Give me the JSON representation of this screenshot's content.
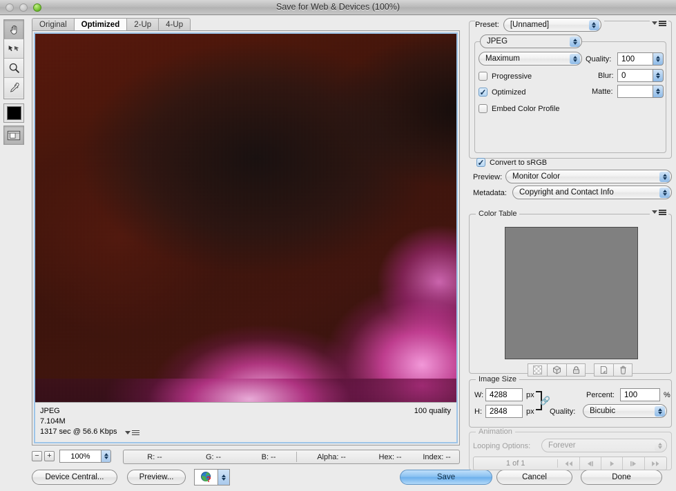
{
  "window": {
    "title": "Save for Web & Devices (100%)",
    "controls": [
      "close-disabled",
      "minimize-disabled",
      "zoom-green"
    ]
  },
  "tools": [
    {
      "name": "hand-tool",
      "icon": "hand-icon",
      "active": true
    },
    {
      "name": "slice-select-tool",
      "icon": "slice-select-icon",
      "active": false
    },
    {
      "name": "zoom-tool",
      "icon": "magnifier-icon",
      "active": false
    },
    {
      "name": "eyedropper-tool",
      "icon": "eyedropper-icon",
      "active": false
    }
  ],
  "foreground_color": "#000000",
  "slice_visibility_toggle": "toggle-slices-icon",
  "tabs": [
    {
      "label": "Original",
      "active": false
    },
    {
      "label": "Optimized",
      "active": true
    },
    {
      "label": "2-Up",
      "active": false
    },
    {
      "label": "4-Up",
      "active": false
    }
  ],
  "preview_status": {
    "format": "JPEG",
    "quality_note": "100 quality",
    "file_size": "7.104M",
    "download_time": "1317 sec @ 56.6 Kbps"
  },
  "zoom_bar": {
    "minus": "−",
    "plus": "+",
    "level": "100%"
  },
  "readout": {
    "r": "R: --",
    "g": "G: --",
    "b": "B: --",
    "alpha": "Alpha: --",
    "hex": "Hex: --",
    "index": "Index: --"
  },
  "settings": {
    "preset_label": "Preset:",
    "preset_value": "[Unnamed]",
    "format_value": "JPEG",
    "compression_value": "Maximum",
    "quality_label": "Quality:",
    "quality_value": "100",
    "blur_label": "Blur:",
    "blur_value": "0",
    "matte_label": "Matte:",
    "matte_value": "",
    "progressive_label": "Progressive",
    "progressive_checked": false,
    "optimized_label": "Optimized",
    "optimized_checked": true,
    "embed_profile_label": "Embed Color Profile",
    "embed_profile_checked": false,
    "convert_srgb_label": "Convert to sRGB",
    "convert_srgb_checked": true,
    "preview_label": "Preview:",
    "preview_value": "Monitor Color",
    "metadata_label": "Metadata:",
    "metadata_value": "Copyright and Contact Info"
  },
  "color_table": {
    "title": "Color Table",
    "swatch_color": "#808080",
    "buttons": [
      {
        "name": "transparency-button",
        "icon": "checkerboard-icon"
      },
      {
        "name": "web-shift-button",
        "icon": "cube-icon"
      },
      {
        "name": "lock-color-button",
        "icon": "lock-icon"
      },
      {
        "name": "new-color-button",
        "icon": "new-page-icon"
      },
      {
        "name": "delete-color-button",
        "icon": "trash-icon"
      }
    ]
  },
  "image_size": {
    "title": "Image Size",
    "w_label": "W:",
    "w_value": "4288",
    "w_unit": "px",
    "h_label": "H:",
    "h_value": "2848",
    "h_unit": "px",
    "percent_label": "Percent:",
    "percent_value": "100",
    "percent_unit": "%",
    "quality_label": "Quality:",
    "quality_value": "Bicubic",
    "constrain_icon": "link-chain-icon"
  },
  "animation": {
    "title": "Animation",
    "looping_label": "Looping Options:",
    "looping_value": "Forever",
    "frame_count": "1 of 1",
    "controls": [
      {
        "name": "first-frame-button",
        "icon": "skip-back-icon"
      },
      {
        "name": "previous-frame-button",
        "icon": "step-back-icon"
      },
      {
        "name": "play-button",
        "icon": "play-icon"
      },
      {
        "name": "next-frame-button",
        "icon": "step-forward-icon"
      },
      {
        "name": "last-frame-button",
        "icon": "skip-forward-icon"
      }
    ]
  },
  "footer": {
    "device_central": "Device Central...",
    "preview": "Preview...",
    "browser_icon": "globe-question-icon",
    "save": "Save",
    "cancel": "Cancel",
    "done": "Done"
  },
  "colors": {
    "accent_blue": "#8cc2f2",
    "panel_bg": "#ebebeb",
    "swatch_gray": "#808080"
  }
}
